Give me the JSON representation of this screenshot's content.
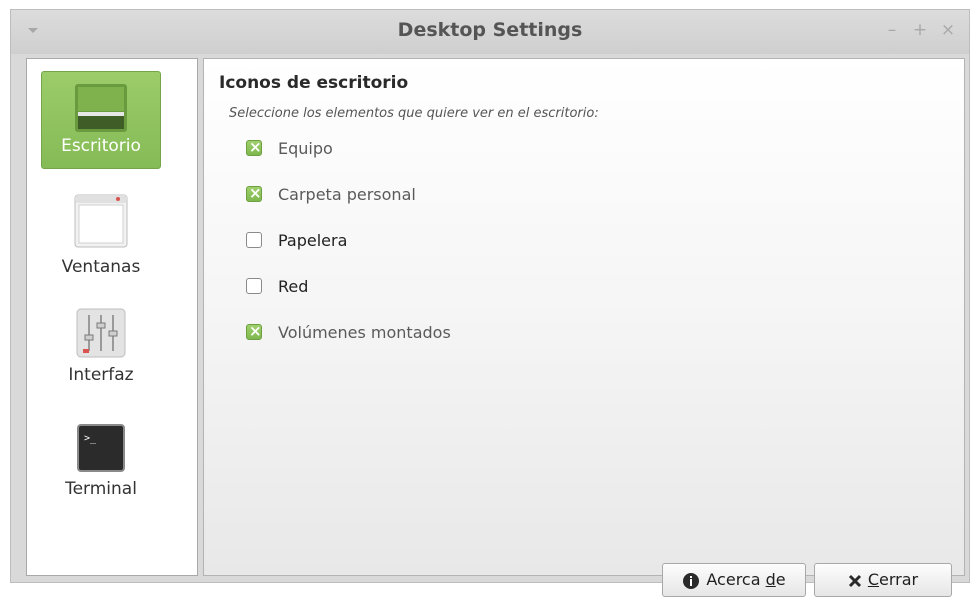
{
  "window": {
    "title": "Desktop Settings",
    "minimize": "–",
    "maximize": "+",
    "close": "×"
  },
  "sidebar": {
    "items": [
      {
        "label": "Escritorio"
      },
      {
        "label": "Ventanas"
      },
      {
        "label": "Interfaz"
      },
      {
        "label": "Terminal"
      }
    ]
  },
  "content": {
    "heading": "Iconos de escritorio",
    "subtitle": "Seleccione los elementos que quiere ver en el escritorio:",
    "options": [
      {
        "label": "Equipo",
        "checked": true
      },
      {
        "label": "Carpeta personal",
        "checked": true
      },
      {
        "label": "Papelera",
        "checked": false
      },
      {
        "label": "Red",
        "checked": false
      },
      {
        "label": "Volúmenes montados",
        "checked": true
      }
    ]
  },
  "buttons": {
    "about": {
      "pre": "Acerca ",
      "mnemonic": "d",
      "post": "e"
    },
    "close": {
      "pre": "",
      "mnemonic": "C",
      "post": "errar"
    }
  },
  "colors": {
    "accent": "#85bb56",
    "check": "#7fb84e"
  }
}
